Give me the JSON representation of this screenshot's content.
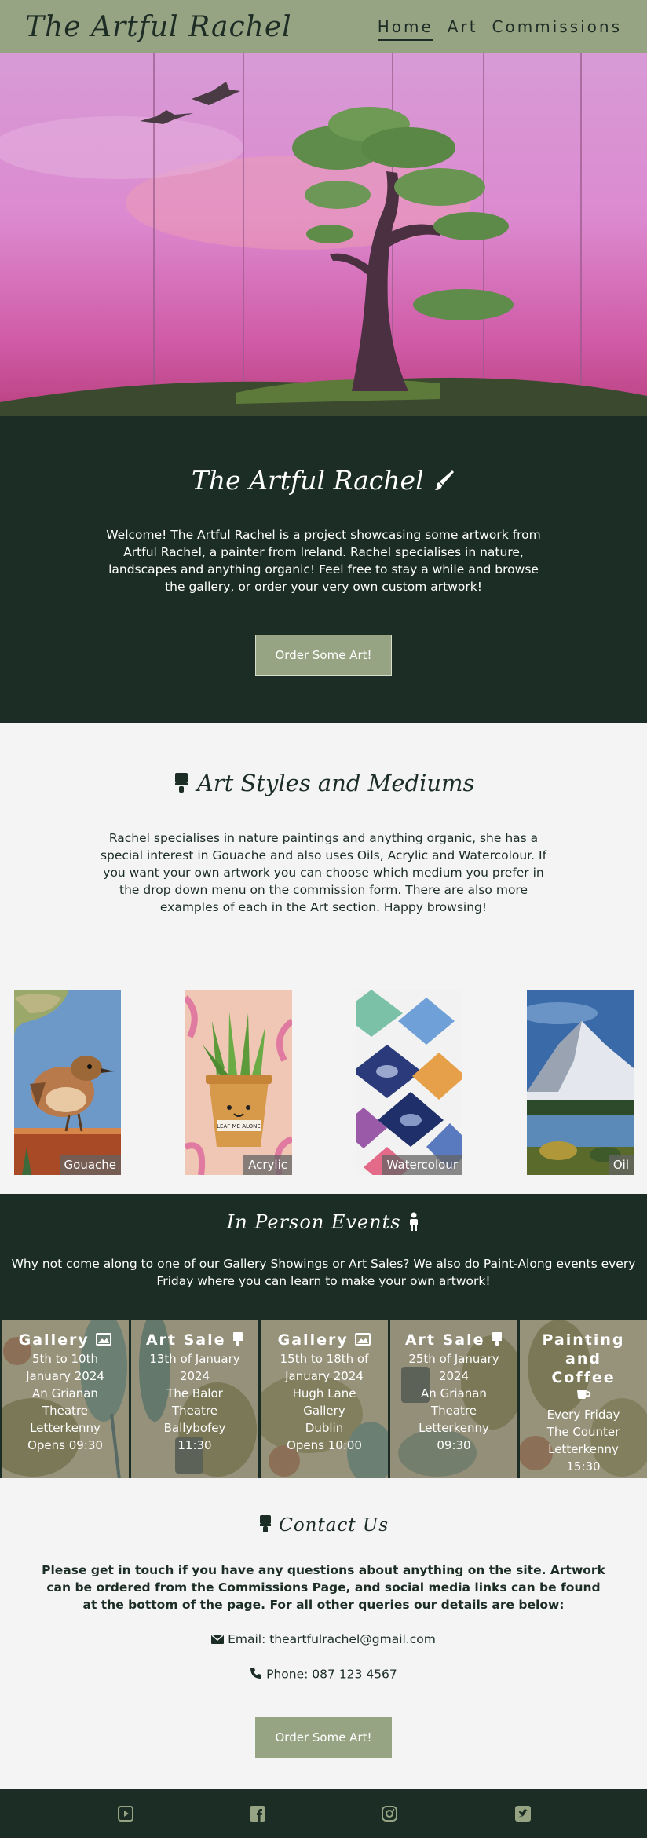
{
  "nav": {
    "logo": "The Artful Rachel",
    "links": [
      "Home",
      "Art",
      "Commissions"
    ],
    "active": "Home"
  },
  "intro": {
    "title": "The Artful Rachel",
    "title_icon": "paint-brush-icon",
    "text": "Welcome! The Artful Rachel is a project showcasing some artwork from Artful Rachel, a painter from Ireland. Rachel specialises in nature, landscapes and anything organic! Feel free to stay a while and browse the gallery, or order your very own custom artwork!",
    "button": "Order Some Art!"
  },
  "styles": {
    "title": "Art Styles and Mediums",
    "title_icon": "paint-brush-icon",
    "text": "Rachel specialises in nature paintings and anything organic, she has a special interest in Gouache and also uses Oils, Acrylic and Watercolour. If you want your own artwork you can choose which medium you prefer in the drop down menu on the commission form. There are also more examples of each in the Art section. Happy browsing!",
    "artworks": [
      {
        "label": "Gouache"
      },
      {
        "label": "Acrylic",
        "sign_text": "LEAF ME ALONE"
      },
      {
        "label": "Watercolour"
      },
      {
        "label": "Oil"
      }
    ]
  },
  "events": {
    "title": "In Person Events",
    "title_icon": "person-icon",
    "text": "Why not come along to one of our Gallery Showings or Art Sales? We also do Paint-Along events every Friday where you can learn to make your own artwork!",
    "cards": [
      {
        "title": "Gallery",
        "icon": "image-icon",
        "lines": [
          "5th to 10th",
          "January 2024",
          "An Grianan",
          "Theatre",
          "Letterkenny",
          "Opens 09:30"
        ]
      },
      {
        "title": "Art Sale",
        "icon": "paint-brush-icon",
        "lines": [
          "13th of January",
          "2024",
          "The Balor",
          "Theatre",
          "Ballybofey",
          "11:30"
        ]
      },
      {
        "title": "Gallery",
        "icon": "image-icon",
        "lines": [
          "15th to 18th of",
          "January 2024",
          "Hugh Lane",
          "Gallery",
          "Dublin",
          "Opens 10:00"
        ]
      },
      {
        "title": "Art Sale",
        "icon": "paint-brush-icon",
        "lines": [
          "25th of January",
          "2024",
          "An Grianan",
          "Theatre",
          "Letterkenny",
          "09:30"
        ]
      },
      {
        "title": "Painting and Coffee",
        "icon": "coffee-icon",
        "lines": [
          "Every Friday",
          "The Counter",
          "Letterkenny",
          "15:30"
        ]
      }
    ]
  },
  "contact": {
    "title": "Contact Us",
    "title_icon": "paint-brush-icon",
    "lead": "Please get in touch if you have any questions about anything on the site. Artwork can be ordered from the Commissions Page, and social media links can be found at the bottom of the page. For all other queries our details are below:",
    "email": "Email: theartfulrachel@gmail.com",
    "phone": "Phone: 087 123 4567",
    "button": "Order Some Art!"
  },
  "footer": {
    "social": [
      "youtube-icon",
      "facebook-icon",
      "instagram-icon",
      "twitter-icon"
    ]
  },
  "colors": {
    "nav_bg": "#97a483",
    "dark_green": "#1b2d25",
    "button_bg": "#97a483",
    "light_bg": "#f4f4f4"
  }
}
